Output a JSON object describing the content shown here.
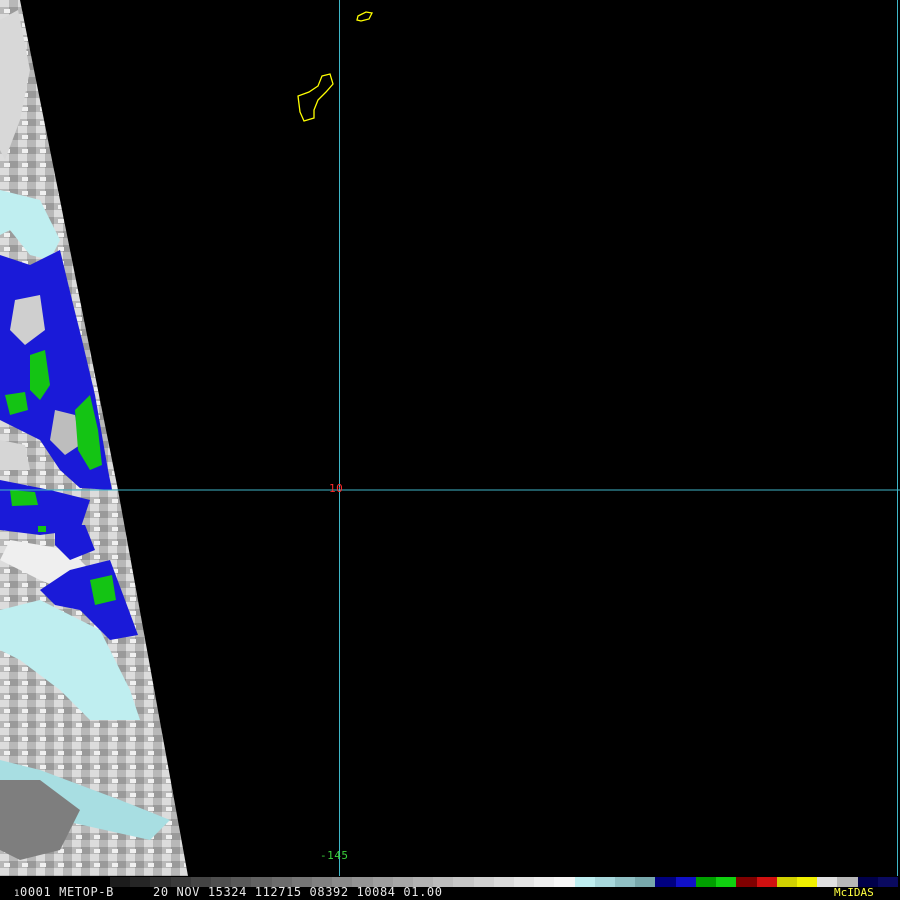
{
  "labels": {
    "latitude": "10",
    "longitude": "-145"
  },
  "status_bar": {
    "frame_prefix": "1",
    "text": "0001 METOP-B     20 NOV 15324 112715 08392 10084 01.00",
    "brand": "McIDAS"
  },
  "colors": {
    "background": "#000000",
    "gridline": "#3fb6c8",
    "coastline": "#ffff00",
    "latitude_label": "#ff2a2a",
    "longitude_label": "#3ad03a",
    "brand_label": "#ffff40",
    "cloud_white": "#e6e6e6",
    "cloud_gray": "#8e8e8e",
    "cloud_cyan": "#bfeef0",
    "enhancement_blue": "#1a1ad8",
    "enhancement_green": "#14c414"
  },
  "enhancement_scale": [
    "#1c1c1c",
    "#262626",
    "#303030",
    "#3a3a3a",
    "#444444",
    "#4e4e4e",
    "#585858",
    "#626262",
    "#6c6c6c",
    "#767676",
    "#808080",
    "#8a8a8a",
    "#949494",
    "#9e9e9e",
    "#a8a8a8",
    "#b2b2b2",
    "#bcbcbc",
    "#c6c6c6",
    "#d0d0d0",
    "#dadada",
    "#e4e4e4",
    "#eeeeee",
    "#f6f6f6",
    "#bfeef0",
    "#a8d8dc",
    "#90c0c4",
    "#78a8ac",
    "#000080",
    "#1010c8",
    "#00a000",
    "#10d010",
    "#800000",
    "#d01010",
    "#d0d000",
    "#f0f000",
    "#e0e0e0",
    "#b8b8b8",
    "#00004a",
    "#0a0a60"
  ]
}
